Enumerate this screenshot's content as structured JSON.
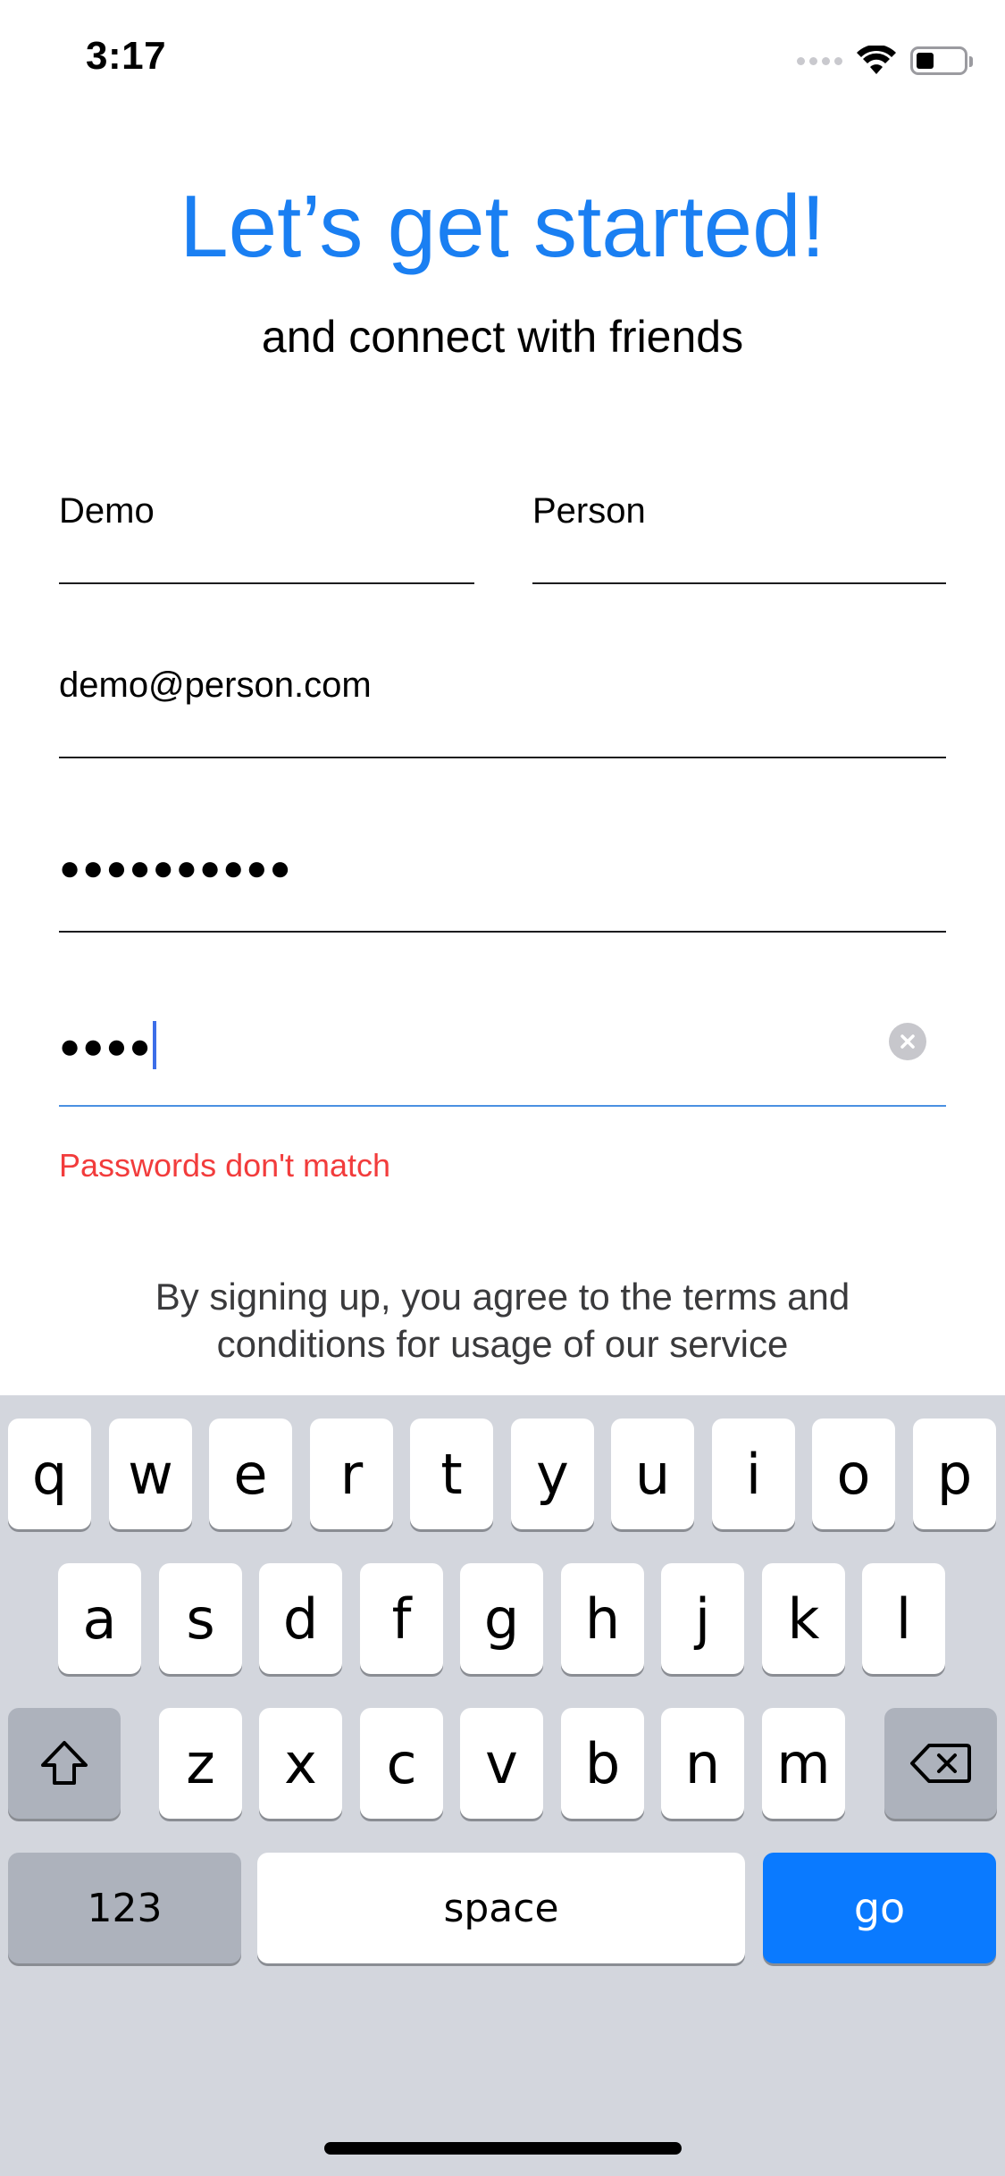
{
  "status_bar": {
    "time": "3:17",
    "icons": [
      "cellular-signal-icon",
      "wifi-icon",
      "battery-icon"
    ]
  },
  "header": {
    "title": "Let’s get started!",
    "subtitle": "and connect with friends"
  },
  "form": {
    "first_name": "Demo",
    "last_name": "Person",
    "email": "demo@person.com",
    "password_masked": "●●●●●●●●●●",
    "confirm_password_masked": "●●●●",
    "error_message": "Passwords don't match",
    "terms_line1": "By signing up, you agree to the terms and",
    "terms_line2": "conditions for usage of our service"
  },
  "keyboard": {
    "row1": [
      "q",
      "w",
      "e",
      "r",
      "t",
      "y",
      "u",
      "i",
      "o",
      "p"
    ],
    "row2": [
      "a",
      "s",
      "d",
      "f",
      "g",
      "h",
      "j",
      "k",
      "l"
    ],
    "row3": [
      "z",
      "x",
      "c",
      "v",
      "b",
      "n",
      "m"
    ],
    "numbers_label": "123",
    "space_label": "space",
    "go_label": "go"
  },
  "colors": {
    "accent": "#1a7ff2",
    "error": "#f23c3c",
    "go_key": "#0a7aff"
  }
}
